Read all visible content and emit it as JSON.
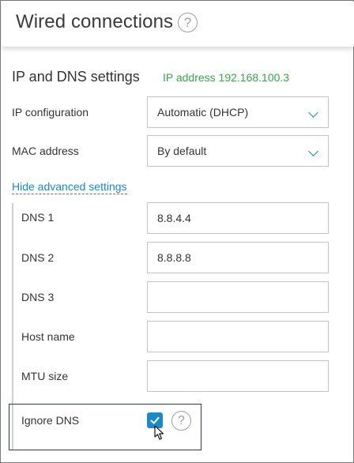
{
  "header": {
    "title": "Wired connections",
    "help": "?"
  },
  "section": {
    "title": "IP and DNS settings",
    "status": "IP address 192.168.100.3"
  },
  "ip_config": {
    "label": "IP configuration",
    "value": "Automatic (DHCP)"
  },
  "mac": {
    "label": "MAC address",
    "value": "By default"
  },
  "advanced": {
    "toggle_label": "Hide advanced settings"
  },
  "dns1": {
    "label": "DNS 1",
    "value": "8.8.4.4"
  },
  "dns2": {
    "label": "DNS 2",
    "value": "8.8.8.8"
  },
  "dns3": {
    "label": "DNS 3",
    "value": ""
  },
  "hostname": {
    "label": "Host name",
    "value": ""
  },
  "mtu": {
    "label": "MTU size",
    "value": ""
  },
  "ignore_dns": {
    "label": "Ignore DNS",
    "checked": true,
    "help": "?"
  },
  "colors": {
    "accent": "#1d88c7",
    "success": "#3aa34b",
    "border": "#c4c4c4",
    "text": "#333333"
  }
}
